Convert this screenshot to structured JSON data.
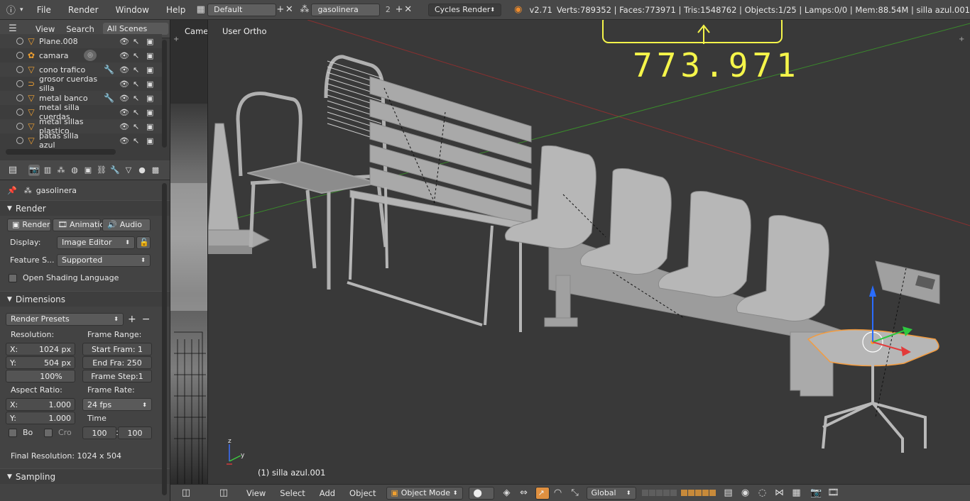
{
  "header": {
    "menus": [
      "File",
      "Render",
      "Window",
      "Help"
    ],
    "screen_layout": "Default",
    "scene": "gasolinera",
    "scene_users": "2",
    "engine": "Cycles Render",
    "version": "v2.71",
    "stats": "Verts:789352 | Faces:773971 | Tris:1548762 | Objects:1/25 | Lamps:0/0 | Mem:88.54M | silla azul.001"
  },
  "annotation": {
    "text": "773.971",
    "color": "#f5f54a"
  },
  "outliner": {
    "menus": [
      "View",
      "Search"
    ],
    "filter": "All Scenes",
    "items": [
      {
        "label": "Plane.008",
        "type": "mesh"
      },
      {
        "label": "camara",
        "type": "camera"
      },
      {
        "label": "cono trafico",
        "type": "mesh"
      },
      {
        "label": "grosor cuerdas silla",
        "type": "curve"
      },
      {
        "label": "metal banco",
        "type": "mesh"
      },
      {
        "label": "metal silla cuerdas",
        "type": "mesh"
      },
      {
        "label": "metal sillas plastico",
        "type": "mesh"
      },
      {
        "label": "patas silla azul",
        "type": "mesh"
      }
    ]
  },
  "properties": {
    "context": "gasolinera",
    "render_panel": {
      "title": "Render",
      "render_btn": "Render",
      "animation_btn": "Animatio",
      "audio_btn": "Audio",
      "display_label": "Display:",
      "display_value": "Image Editor",
      "feature_label": "Feature S...",
      "feature_value": "Supported",
      "osl_label": "Open Shading Language"
    },
    "dimensions_panel": {
      "title": "Dimensions",
      "presets": "Render Presets",
      "resolution_label": "Resolution:",
      "res_x": "X:",
      "res_x_val": "1024 px",
      "res_y": "Y:",
      "res_y_val": "504 px",
      "res_pct": "100%",
      "frame_range_label": "Frame Range:",
      "start": "Start Fram: 1",
      "end": "End Fra: 250",
      "step": "Frame Step:1",
      "aspect_label": "Aspect Ratio:",
      "asp_x": "X:",
      "asp_x_val": "1.000",
      "asp_y": "Y:",
      "asp_y_val": "1.000",
      "frame_rate_label": "Frame Rate:",
      "fps": "24 fps",
      "time_remap_label": "Time Remapping:",
      "remap_old": "100",
      "remap_new": "100",
      "border_label": "Bo",
      "crop_label": "Cro",
      "final_res": "Final Resolution: 1024 x 504"
    },
    "sampling_panel": {
      "title": "Sampling"
    }
  },
  "viewport": {
    "view_label": "User Ortho",
    "cam_label": "Camer",
    "active_object": "(1) silla azul.001"
  },
  "bottombar": {
    "menus": [
      "View",
      "Select",
      "Add",
      "Object"
    ],
    "mode": "Object Mode",
    "orientation": "Global"
  }
}
